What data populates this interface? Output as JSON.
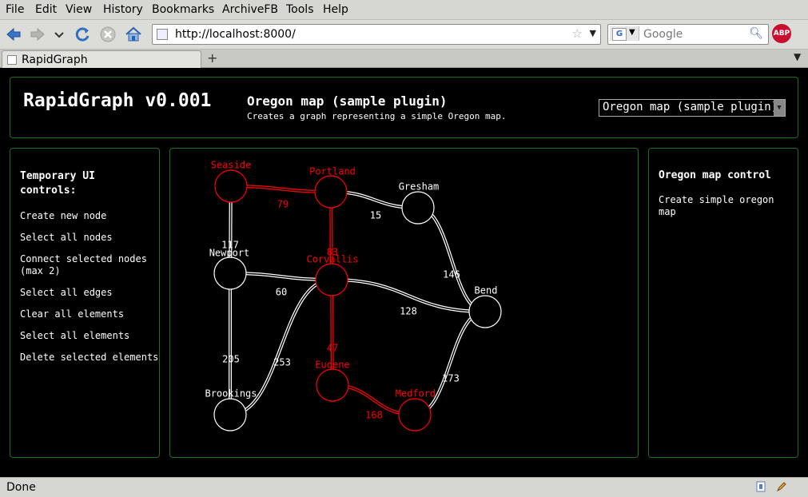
{
  "browser": {
    "menu": [
      "File",
      "Edit",
      "View",
      "History",
      "Bookmarks",
      "ArchiveFB",
      "Tools",
      "Help"
    ],
    "url": "http://localhost:8000/",
    "search_placeholder": "Google",
    "adblock_label": "ABP",
    "tab_title": "RapidGraph",
    "status": "Done"
  },
  "app": {
    "title": "RapidGraph v0.001",
    "plugin_name": "Oregon map (sample plugin)",
    "plugin_desc": "Creates a graph representing a simple Oregon map.",
    "plugin_selected": "Oregon map (sample plugin)"
  },
  "left_panel": {
    "title": "Temporary UI controls:",
    "controls": [
      "Create new node",
      "Select all nodes",
      "Connect selected nodes (max 2)",
      "Select all edges",
      "Clear all elements",
      "Select all elements",
      "Delete selected elements"
    ]
  },
  "right_panel": {
    "title": "Oregon map control",
    "item": "Create simple oregon map"
  },
  "colors": {
    "selected": "#ff0000",
    "unselected": "#ffffff",
    "panel_border": "#1d6e1d",
    "background": "#000000"
  },
  "graph": {
    "nodes": [
      {
        "id": "seaside",
        "label": "Seaside",
        "selected": true
      },
      {
        "id": "portland",
        "label": "Portland",
        "selected": true
      },
      {
        "id": "gresham",
        "label": "Gresham",
        "selected": false
      },
      {
        "id": "newport",
        "label": "Newport",
        "selected": false
      },
      {
        "id": "corvallis",
        "label": "Corvallis",
        "selected": true
      },
      {
        "id": "bend",
        "label": "Bend",
        "selected": false
      },
      {
        "id": "eugene",
        "label": "Eugene",
        "selected": true
      },
      {
        "id": "brookings",
        "label": "Brookings",
        "selected": false
      },
      {
        "id": "medford",
        "label": "Medford",
        "selected": true
      }
    ],
    "edges": [
      {
        "from": "seaside",
        "to": "portland",
        "weight": "79",
        "selected": true
      },
      {
        "from": "portland",
        "to": "gresham",
        "weight": "15",
        "selected": false
      },
      {
        "from": "seaside",
        "to": "newport",
        "weight": "117",
        "selected": false
      },
      {
        "from": "portland",
        "to": "corvallis",
        "weight": "83",
        "selected": true
      },
      {
        "from": "gresham",
        "to": "bend",
        "weight": "146",
        "selected": false
      },
      {
        "from": "newport",
        "to": "corvallis",
        "weight": "60",
        "selected": false
      },
      {
        "from": "corvallis",
        "to": "bend",
        "weight": "128",
        "selected": false
      },
      {
        "from": "newport",
        "to": "brookings",
        "weight": "205",
        "selected": false
      },
      {
        "from": "corvallis",
        "to": "brookings",
        "weight": "253",
        "selected": false
      },
      {
        "from": "corvallis",
        "to": "eugene",
        "weight": "47",
        "selected": true
      },
      {
        "from": "eugene",
        "to": "medford",
        "weight": "168",
        "selected": true
      },
      {
        "from": "medford",
        "to": "bend",
        "weight": "173",
        "selected": false
      }
    ]
  }
}
